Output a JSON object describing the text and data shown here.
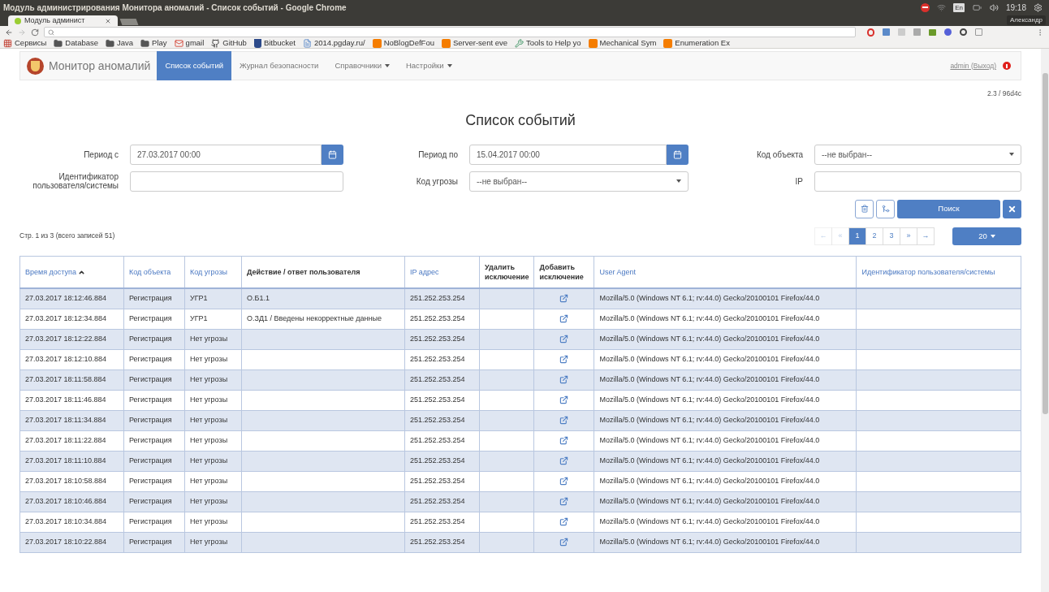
{
  "window": {
    "title": "Модуль администрирования Монитора аномалий - Список событий - Google Chrome"
  },
  "tray": {
    "keyboard": "En",
    "clock": "19:18",
    "user": "Александр"
  },
  "browser": {
    "tabs": [
      {
        "label": "Модуль админист",
        "selected": true
      }
    ],
    "bookmarks": [
      {
        "label": "Сервисы",
        "kind": "apps"
      },
      {
        "label": "Database",
        "kind": "folder"
      },
      {
        "label": "Java",
        "kind": "folder"
      },
      {
        "label": "Play",
        "kind": "folder"
      },
      {
        "label": "gmail",
        "kind": "mail"
      },
      {
        "label": "GitHub",
        "kind": "github"
      },
      {
        "label": "Bitbucket",
        "kind": "bucket"
      },
      {
        "label": "2014.pgday.ru/",
        "kind": "page"
      },
      {
        "label": "NoBlogDefFou",
        "kind": "blog"
      },
      {
        "label": "Server-sent eve",
        "kind": "blog"
      },
      {
        "label": "Tools to Help yo",
        "kind": "tools"
      },
      {
        "label": "Mechanical Sym",
        "kind": "blog"
      },
      {
        "label": "Enumeration Ex",
        "kind": "blog"
      }
    ]
  },
  "navbar": {
    "brand": "Монитор аномалий",
    "items": [
      {
        "label": "Список событий",
        "selected": true,
        "dropdown": false
      },
      {
        "label": "Журнал безопасности",
        "selected": false,
        "dropdown": false
      },
      {
        "label": "Справочники",
        "selected": false,
        "dropdown": true
      },
      {
        "label": "Настройки",
        "selected": false,
        "dropdown": true
      }
    ],
    "user_link": "admin (Выход)"
  },
  "version": "2.3 / 96d4c",
  "page_title": "Список событий",
  "filters": [
    {
      "label": "Период с",
      "kind": "date",
      "value": "27.03.2017 00:00"
    },
    {
      "label": "Период по",
      "kind": "date",
      "value": "15.04.2017 00:00"
    },
    {
      "label": "Код объекта",
      "kind": "select",
      "value": "--не выбран--"
    },
    {
      "label": "Идентификатор пользователя/системы",
      "kind": "text"
    },
    {
      "label": "Код угрозы",
      "kind": "select",
      "value": "--не выбран--"
    },
    {
      "label": "IP",
      "kind": "text"
    }
  ],
  "search_button": "Поиск",
  "summary": "Стр. 1 из 3 (всего записей 51)",
  "pagination": [
    {
      "label": "←",
      "selected": false,
      "disabled": true
    },
    {
      "label": "«",
      "selected": false,
      "disabled": true
    },
    {
      "label": "1",
      "selected": true,
      "disabled": false
    },
    {
      "label": "2",
      "selected": false,
      "disabled": false
    },
    {
      "label": "3",
      "selected": false,
      "disabled": false
    },
    {
      "label": "»",
      "selected": false,
      "disabled": false
    },
    {
      "label": "→",
      "selected": false,
      "disabled": false
    }
  ],
  "page_size": "20",
  "table": {
    "columns": [
      {
        "label": "Время доступа",
        "sortable": true,
        "sorted": true
      },
      {
        "label": "Код объекта",
        "sortable": true,
        "sorted": false
      },
      {
        "label": "Код угрозы",
        "sortable": true,
        "sorted": false
      },
      {
        "label": "Действие / ответ пользователя",
        "sortable": false,
        "sorted": false
      },
      {
        "label": "IP адрес",
        "sortable": true,
        "sorted": false
      },
      {
        "label": "Удалить исключение",
        "sortable": false,
        "sorted": false
      },
      {
        "label": "Добавить исключение",
        "sortable": false,
        "sorted": false
      },
      {
        "label": "User Agent",
        "sortable": true,
        "sorted": false
      },
      {
        "label": "Идентификатор пользователя/системы",
        "sortable": true,
        "sorted": false
      }
    ],
    "rows": [
      {
        "time": "27.03.2017 18:12:46.884",
        "object": "Регистрация",
        "threat": "УГР1",
        "action": "О.Б1.1",
        "ip": "251.252.253.254",
        "add_exception": true,
        "agent": "Mozilla/5.0 (Windows NT 6.1; rv:44.0) Gecko/20100101 Firefox/44.0"
      },
      {
        "time": "27.03.2017 18:12:34.884",
        "object": "Регистрация",
        "threat": "УГР1",
        "action": "О.ЗД1 / Введены некорректные данные",
        "ip": "251.252.253.254",
        "add_exception": true,
        "agent": "Mozilla/5.0 (Windows NT 6.1; rv:44.0) Gecko/20100101 Firefox/44.0"
      },
      {
        "time": "27.03.2017 18:12:22.884",
        "object": "Регистрация",
        "threat": "Нет угрозы",
        "ip": "251.252.253.254",
        "add_exception": true,
        "agent": "Mozilla/5.0 (Windows NT 6.1; rv:44.0) Gecko/20100101 Firefox/44.0"
      },
      {
        "time": "27.03.2017 18:12:10.884",
        "object": "Регистрация",
        "threat": "Нет угрозы",
        "ip": "251.252.253.254",
        "add_exception": true,
        "agent": "Mozilla/5.0 (Windows NT 6.1; rv:44.0) Gecko/20100101 Firefox/44.0"
      },
      {
        "time": "27.03.2017 18:11:58.884",
        "object": "Регистрация",
        "threat": "Нет угрозы",
        "ip": "251.252.253.254",
        "add_exception": true,
        "agent": "Mozilla/5.0 (Windows NT 6.1; rv:44.0) Gecko/20100101 Firefox/44.0"
      },
      {
        "time": "27.03.2017 18:11:46.884",
        "object": "Регистрация",
        "threat": "Нет угрозы",
        "ip": "251.252.253.254",
        "add_exception": true,
        "agent": "Mozilla/5.0 (Windows NT 6.1; rv:44.0) Gecko/20100101 Firefox/44.0"
      },
      {
        "time": "27.03.2017 18:11:34.884",
        "object": "Регистрация",
        "threat": "Нет угрозы",
        "ip": "251.252.253.254",
        "add_exception": true,
        "agent": "Mozilla/5.0 (Windows NT 6.1; rv:44.0) Gecko/20100101 Firefox/44.0"
      },
      {
        "time": "27.03.2017 18:11:22.884",
        "object": "Регистрация",
        "threat": "Нет угрозы",
        "ip": "251.252.253.254",
        "add_exception": true,
        "agent": "Mozilla/5.0 (Windows NT 6.1; rv:44.0) Gecko/20100101 Firefox/44.0"
      },
      {
        "time": "27.03.2017 18:11:10.884",
        "object": "Регистрация",
        "threat": "Нет угрозы",
        "ip": "251.252.253.254",
        "add_exception": true,
        "agent": "Mozilla/5.0 (Windows NT 6.1; rv:44.0) Gecko/20100101 Firefox/44.0"
      },
      {
        "time": "27.03.2017 18:10:58.884",
        "object": "Регистрация",
        "threat": "Нет угрозы",
        "ip": "251.252.253.254",
        "add_exception": true,
        "agent": "Mozilla/5.0 (Windows NT 6.1; rv:44.0) Gecko/20100101 Firefox/44.0"
      },
      {
        "time": "27.03.2017 18:10:46.884",
        "object": "Регистрация",
        "threat": "Нет угрозы",
        "ip": "251.252.253.254",
        "add_exception": true,
        "agent": "Mozilla/5.0 (Windows NT 6.1; rv:44.0) Gecko/20100101 Firefox/44.0"
      },
      {
        "time": "27.03.2017 18:10:34.884",
        "object": "Регистрация",
        "threat": "Нет угрозы",
        "ip": "251.252.253.254",
        "add_exception": true,
        "agent": "Mozilla/5.0 (Windows NT 6.1; rv:44.0) Gecko/20100101 Firefox/44.0"
      },
      {
        "time": "27.03.2017 18:10:22.884",
        "object": "Регистрация",
        "threat": "Нет угрозы",
        "ip": "251.252.253.254",
        "add_exception": true,
        "agent": "Mozilla/5.0 (Windows NT 6.1; rv:44.0) Gecko/20100101 Firefox/44.0"
      }
    ]
  }
}
